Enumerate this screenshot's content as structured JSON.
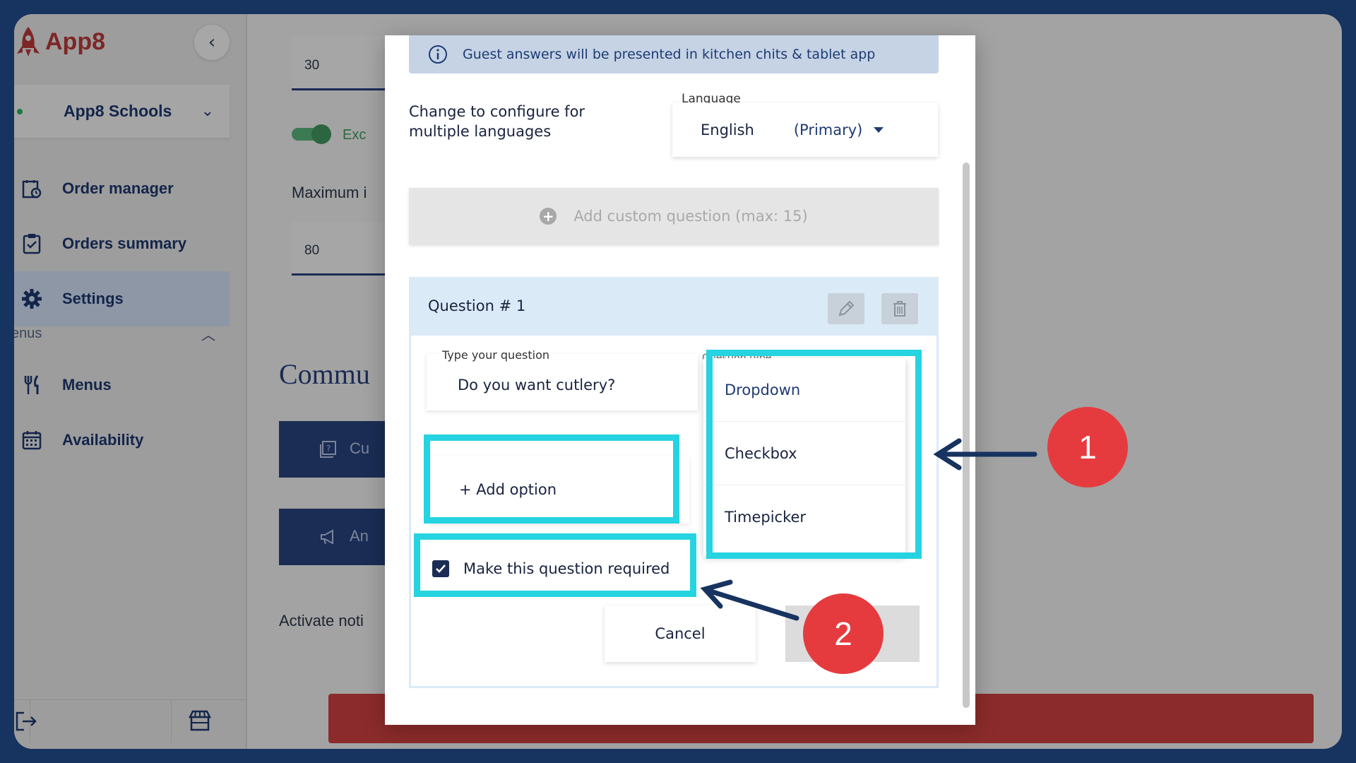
{
  "app": {
    "name": "App8"
  },
  "sidebar": {
    "org_name": "App8 Schools",
    "items": [
      {
        "label": "Order manager",
        "icon": "order-manager-icon"
      },
      {
        "label": "Orders summary",
        "icon": "clipboard-check-icon"
      },
      {
        "label": "Settings",
        "icon": "gear-icon",
        "active": true
      }
    ],
    "section": {
      "label": "enus"
    },
    "menu_items": [
      {
        "label": "Menus",
        "icon": "utensils-icon"
      },
      {
        "label": "Availability",
        "icon": "calendar-icon"
      }
    ]
  },
  "background": {
    "field1_value": "30",
    "toggle_label": "Exc",
    "max_label": "Maximum i",
    "field2_value": "80",
    "section_title": "Commu",
    "button1_label": "Cu",
    "button2_label": "An",
    "activate_label": "Activate noti"
  },
  "modal": {
    "info_text": "Guest answers will be presented in kitchen chits & tablet app",
    "config_label": "Change to configure for multiple languages",
    "language_label": "Language",
    "language_value": "English",
    "language_primary": "(Primary)",
    "add_question_label": "Add custom question (max: 15)",
    "question": {
      "title": "Question # 1",
      "input_label": "Type your question",
      "input_value": "Do you want cutlery?",
      "type_label": "Question type",
      "type_options": [
        "Dropdown",
        "Checkbox",
        "Timepicker"
      ],
      "selected_type": "Dropdown",
      "add_option_label": "+ Add option",
      "required_label": "Make this question required",
      "required_checked": true,
      "cancel_label": "Cancel"
    }
  },
  "annotations": {
    "badge1": "1",
    "badge2": "2",
    "highlight_color": "#26d3e0",
    "badge_color": "#e53b3f",
    "arrow_color": "#17335f"
  }
}
